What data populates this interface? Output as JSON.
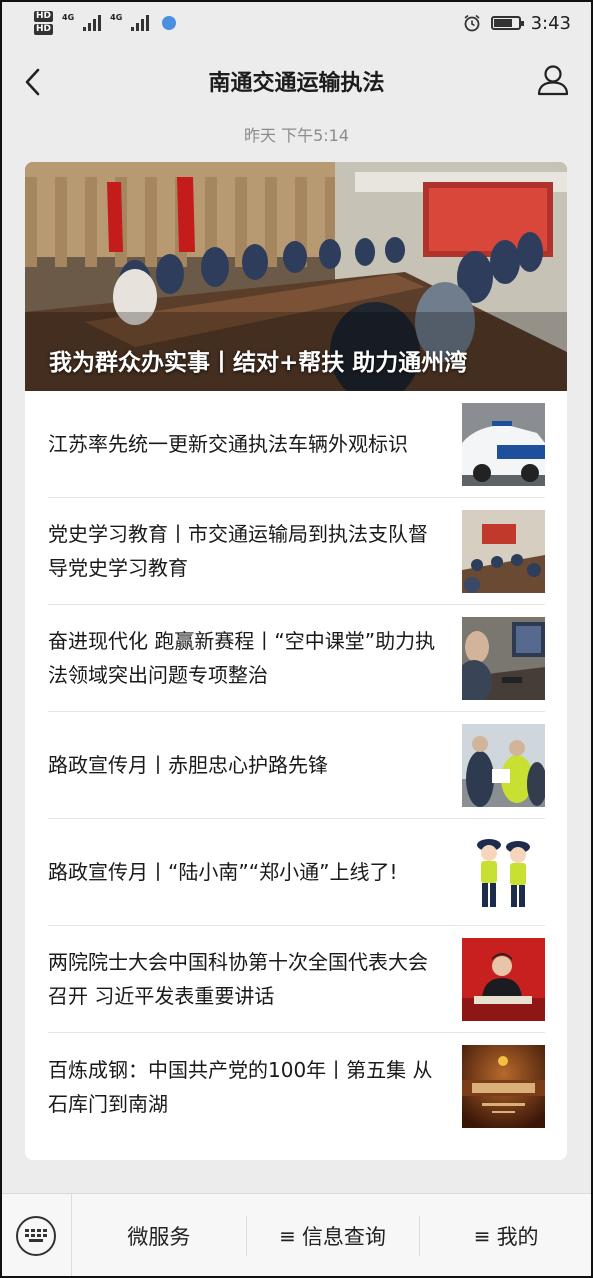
{
  "status_bar": {
    "hd1": "HD",
    "hd2": "HD",
    "net1": "4G",
    "net2": "4G",
    "time": "3:43"
  },
  "nav": {
    "title": "南通交通运输执法"
  },
  "message_time": "昨天 下午5:14",
  "cover": {
    "title": "我为群众办实事丨结对+帮扶 助力通州湾"
  },
  "articles": [
    {
      "title": "江苏率先统一更新交通执法车辆外观标识"
    },
    {
      "title": "党史学习教育丨市交通运输局到执法支队督导党史学习教育"
    },
    {
      "title": "奋进现代化 跑赢新赛程丨“空中课堂”助力执法领域突出问题专项整治"
    },
    {
      "title": "路政宣传月丨赤胆忠心护路先锋"
    },
    {
      "title": "路政宣传月丨“陆小南”“郑小通”上线了!"
    },
    {
      "title": "两院院士大会中国科协第十次全国代表大会召开 习近平发表重要讲话"
    },
    {
      "title": "百炼成钢：中国共产党的100年丨第五集 从石库门到南湖"
    }
  ],
  "bottom_menu": {
    "item1": "微服务",
    "item2_prefix": "≡",
    "item2": "信息查询",
    "item3_prefix": "≡",
    "item3": "我的"
  },
  "colors": {
    "background": "#ececec",
    "card": "#ffffff",
    "meta_text": "#8c8c8c",
    "accent_red": "#c0392b"
  }
}
